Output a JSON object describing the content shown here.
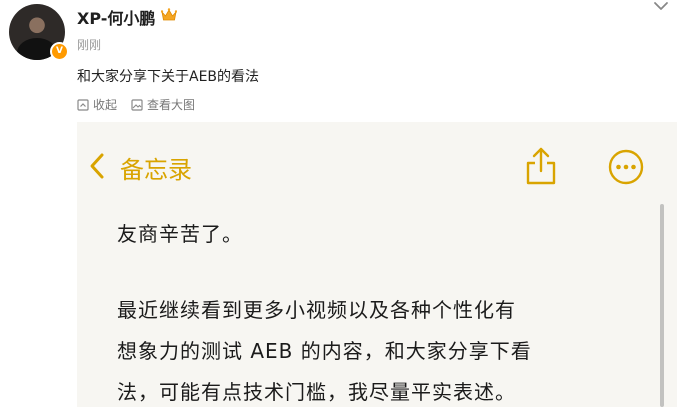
{
  "post": {
    "username": "XP-何小鹏",
    "timestamp": "刚刚",
    "text": "和大家分享下关于AEB的看法",
    "verified_badge": "V",
    "colors": {
      "badge": "#ff9a00",
      "crown": "#f5a623"
    }
  },
  "image_toolbar": {
    "collapse_label": "收起",
    "view_large_label": "查看大图"
  },
  "note": {
    "back_label": "备忘录",
    "accent_color": "#d9a400",
    "lines": [
      "友商辛苦了。",
      "最近继续看到更多小视频以及各种个性化有",
      "想象力的测试 AEB 的内容，和大家分享下看",
      "法，可能有点技术门槛，我尽量平实表述。"
    ]
  },
  "icons": {
    "crown": "crown-icon",
    "chevron": "chevron-down-icon",
    "collapse": "collapse-icon",
    "view_large": "image-icon",
    "back": "chevron-left-icon",
    "share": "share-icon",
    "more": "more-icon"
  }
}
